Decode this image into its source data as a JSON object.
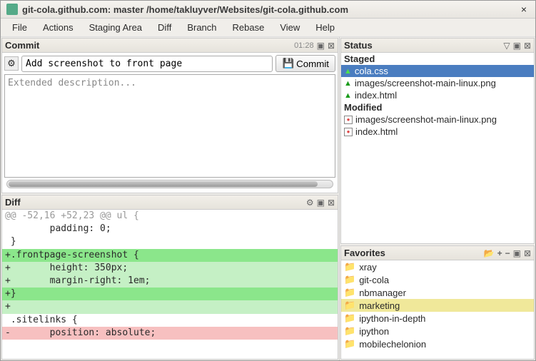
{
  "titlebar": "git-cola.github.com: master /home/takluyver/Websites/git-cola.github.com",
  "menu": [
    "File",
    "Actions",
    "Staging Area",
    "Diff",
    "Branch",
    "Rebase",
    "View",
    "Help"
  ],
  "commit": {
    "title": "Commit",
    "col_count": "01:28",
    "summary": "Add screenshot to front page",
    "btn": "Commit",
    "ext_placeholder": "Extended description..."
  },
  "diff": {
    "title": "Diff",
    "lines": [
      {
        "cls": "d-hunk",
        "t": "@@ -52,16 +52,23 @@ ul {"
      },
      {
        "cls": "",
        "t": "        padding: 0;"
      },
      {
        "cls": "",
        "t": " }"
      },
      {
        "cls": "",
        "t": ""
      },
      {
        "cls": "d-add-green",
        "t": "+.frontpage-screenshot {"
      },
      {
        "cls": "d-add",
        "t": "+       height: 350px;"
      },
      {
        "cls": "d-add",
        "t": "+       margin-right: 1em;"
      },
      {
        "cls": "d-add-green",
        "t": "+}"
      },
      {
        "cls": "d-add",
        "t": "+"
      },
      {
        "cls": "",
        "t": " .sitelinks {"
      },
      {
        "cls": "d-del",
        "t": "-       position: absolute;"
      }
    ]
  },
  "status": {
    "title": "Status",
    "groups": [
      {
        "name": "Staged",
        "files": [
          {
            "icon": "tri",
            "name": "cola.css",
            "selected": true
          },
          {
            "icon": "tri",
            "name": "images/screenshot-main-linux.png"
          },
          {
            "icon": "tri",
            "name": "index.html"
          }
        ]
      },
      {
        "name": "Modified",
        "files": [
          {
            "icon": "mod",
            "name": "images/screenshot-main-linux.png"
          },
          {
            "icon": "mod",
            "name": "index.html"
          }
        ]
      }
    ]
  },
  "favorites": {
    "title": "Favorites",
    "items": [
      "xray",
      "git-cola",
      "nbmanager",
      "marketing",
      "ipython-in-depth",
      "ipython",
      "mobilechelonion"
    ],
    "highlight": "marketing"
  }
}
